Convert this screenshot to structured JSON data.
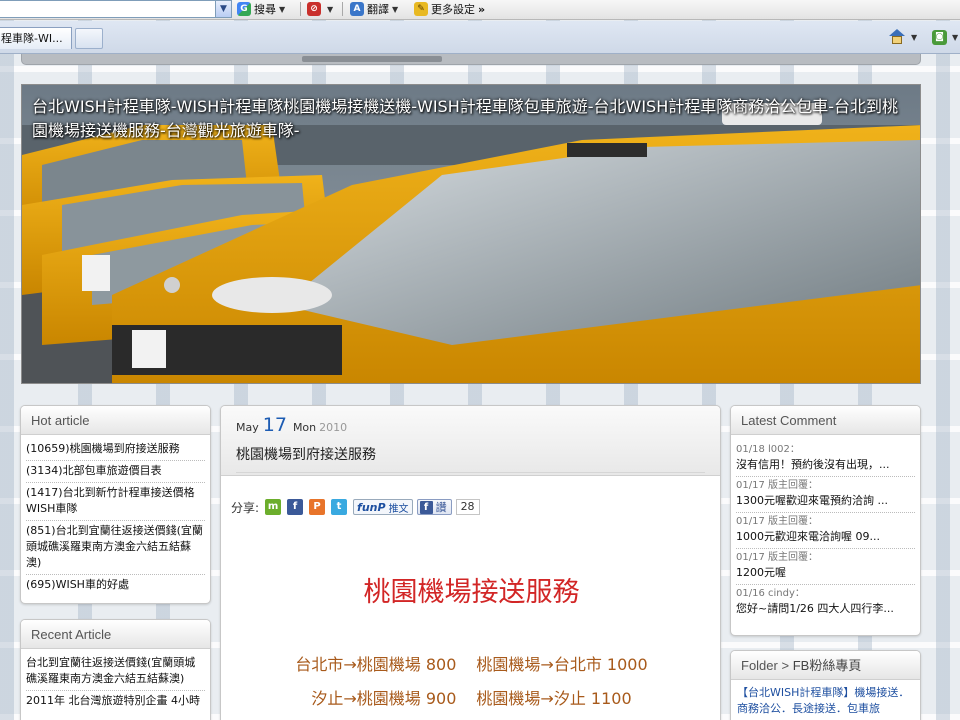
{
  "browser": {
    "toolbar": {
      "search_label": "搜尋",
      "translate_label": "翻譯",
      "more_settings_label": "更多設定",
      "more_arrow": "»"
    },
    "tab": {
      "label": "程車隊-WI..."
    }
  },
  "site": {
    "banner_title": "台北WISH計程車隊-WISH計程車隊桃園機場接機送機-WISH計程車隊包車旅遊-台北WISH計程車隊商務洽公包車-台北到桃園機場接送機服務-台灣觀光旅遊車隊-"
  },
  "hot_article": {
    "title": "Hot article",
    "items": [
      "(10659)桃園機場到府接送服務",
      "(3134)北部包車旅遊價目表",
      "(1417)台北到新竹計程車接送價格WISH車隊",
      "(851)台北到宜蘭往返接送價錢(宜蘭頭城礁溪羅東南方澳金六結五結蘇澳)",
      "(695)WISH車的好處"
    ]
  },
  "recent_article": {
    "title": "Recent Article",
    "items": [
      "台北到宜蘭往返接送價錢(宜蘭頭城礁溪羅東南方澳金六結五結蘇澳)",
      "2011年 北台灣旅遊特別企畫 4小時"
    ]
  },
  "post": {
    "date": {
      "month": "May",
      "day": "17",
      "dow": "Mon",
      "year": "2010"
    },
    "title": "桃園機場到府接送服務",
    "share_label": "分享:",
    "funp_logo": "funP",
    "funp_text": "推文",
    "fb_like_label": "讚",
    "like_count": "28",
    "heading": "桃園機場接送服務",
    "prices": [
      {
        "left": "台北市→桃園機場 800",
        "right": "桃園機場→台北市 1000"
      },
      {
        "left": "汐止→桃園機場 900",
        "right": "桃園機場→汐止 1100"
      }
    ]
  },
  "latest_comment": {
    "title": "Latest Comment",
    "items": [
      {
        "meta": "01/18 l002：",
        "text": "沒有信用！預約後沒有出現，..."
      },
      {
        "meta": "01/17 版主回覆：",
        "text": "1300元喔歡迎來電預約洽詢 ..."
      },
      {
        "meta": "01/17 版主回覆：",
        "text": "1000元歡迎來電洽詢喔 09..."
      },
      {
        "meta": "01/17 版主回覆：",
        "text": "1200元喔"
      },
      {
        "meta": "01/16 cindy：",
        "text": "您好~請問1/26 四大人四行李..."
      }
    ]
  },
  "folder": {
    "title": "Folder",
    "separator": ">",
    "crumb": "FB粉絲專頁",
    "text": "【台北WISH計程車隊】機場接送．商務洽公．長途接送．包車旅"
  },
  "colors": {
    "accent_blue": "#1d5cb3",
    "heading_red": "#d22626",
    "price_brown": "#a85a1b"
  }
}
